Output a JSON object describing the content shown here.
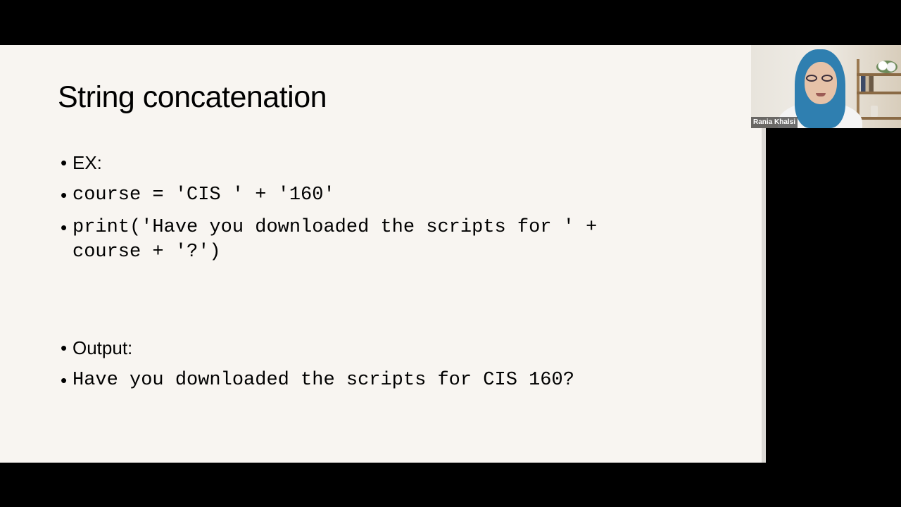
{
  "slide": {
    "title": "String concatenation",
    "bullets": [
      {
        "symbol": "•",
        "text": "EX:"
      },
      {
        "symbol": "•",
        "text": "course = 'CIS ' + '160'"
      },
      {
        "symbol": "•",
        "text": "print('Have you downloaded the scripts for ' +\ncourse + '?')"
      },
      {
        "symbol": "•",
        "text": "Output:"
      },
      {
        "symbol": "•",
        "text": "Have you downloaded the scripts for CIS 160?"
      }
    ],
    "background_color": "#f8f5f1"
  },
  "participant_video": {
    "name": "Rania Khalsi"
  }
}
